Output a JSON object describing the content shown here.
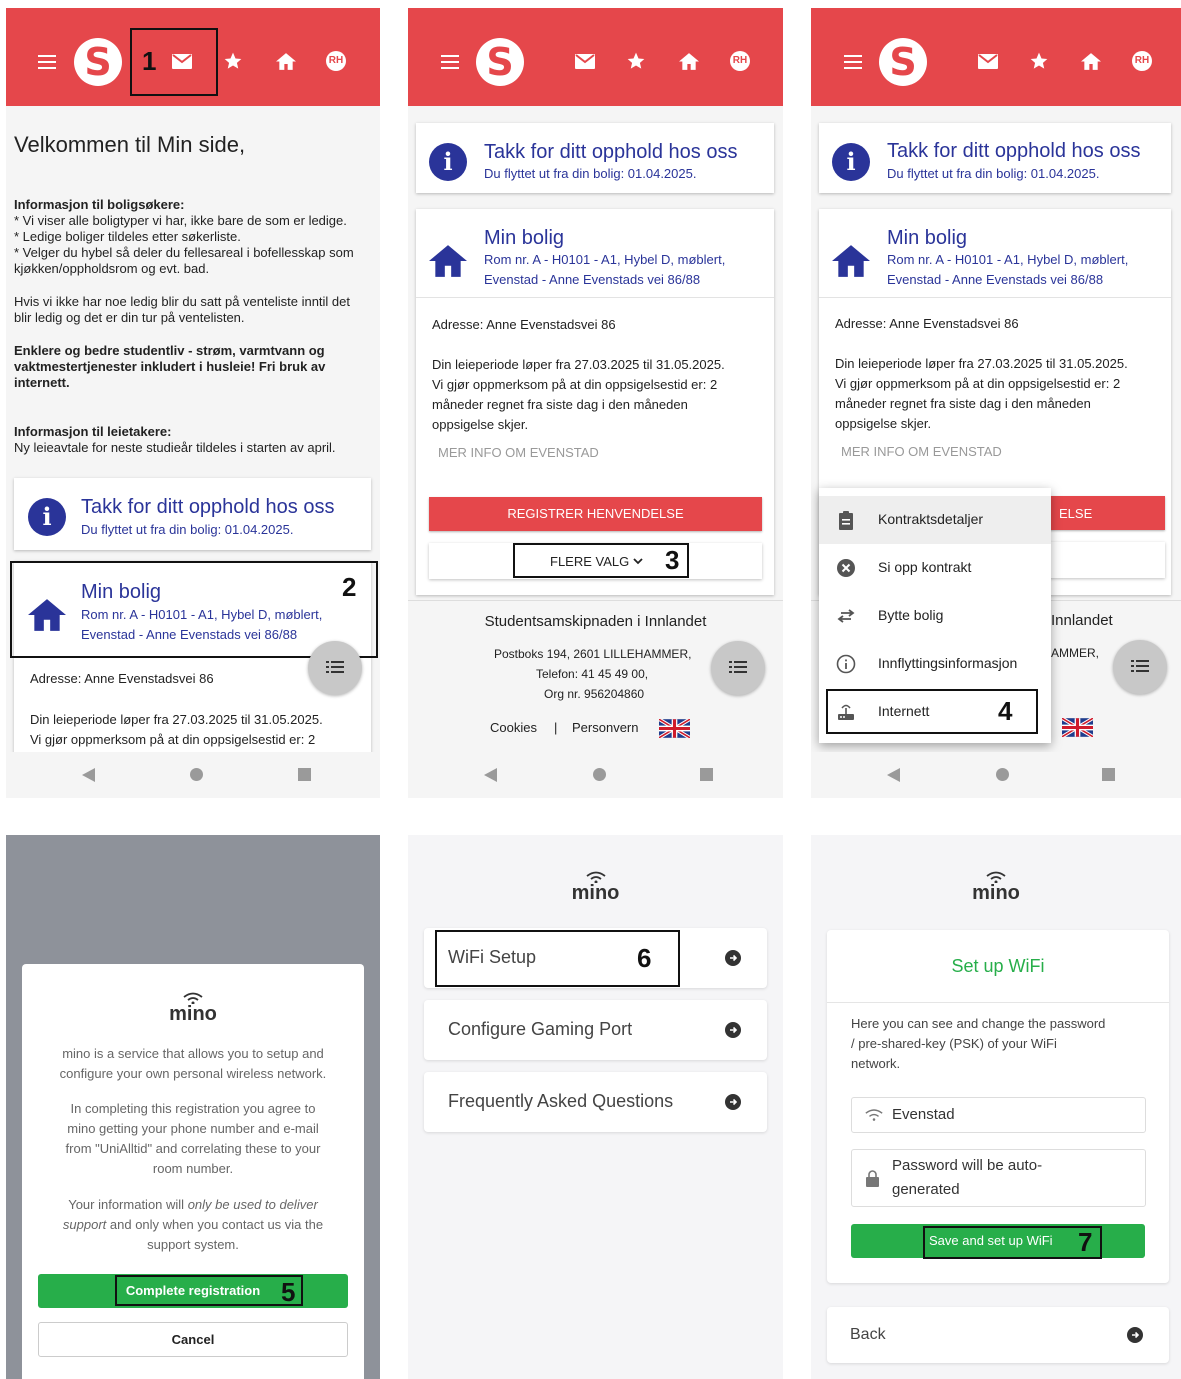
{
  "colors": {
    "brand_red": "#e5474b",
    "brand_blue": "#2a3499",
    "mino_green": "#27ae4a"
  },
  "appbar": {
    "avatar_initials": "RH",
    "logo_letter": "S"
  },
  "steps": [
    "1",
    "2",
    "3",
    "4",
    "5",
    "6",
    "7"
  ],
  "welcome": {
    "heading": "Velkommen til Min side,",
    "sec1_title": "Informasjon til boligsøkere:",
    "sec1_line1": "* Vi viser alle boligtyper vi har, ikke bare de som er ledige.",
    "sec1_line2": "* Ledige boliger tildeles etter søkerliste.",
    "sec1_line3": "* Velger du hybel så deler du fellesareal i bofellesskap som",
    "sec1_line4": "kjøkken/oppholdsrom og evt. bad.",
    "sec2_line1": "Hvis vi ikke har noe ledig blir du satt på venteliste inntil det",
    "sec2_line2": "blir ledig og det er din tur på ventelisten.",
    "sec3_line1": "Enklere og bedre studentliv - strøm, varmtvann og",
    "sec3_line2": "vaktmestertjenester inkludert i husleie! Fri bruk av",
    "sec3_line3": "internett.",
    "sec4_title": "Informasjon til leietakere:",
    "sec4_line1": "Ny leieavtale for neste studieår tildeles i starten av april."
  },
  "thanks": {
    "title": "Takk for ditt opphold hos oss",
    "subtitle": "Du flyttet ut fra din bolig: 01.04.2025."
  },
  "bolig": {
    "title": "Min bolig",
    "line1": "Rom nr. A - H0101 - A1, Hybel D, møblert,",
    "line2": "Evenstad - Anne Evenstads vei 86/88",
    "address": "Adresse: Anne Evenstadsvei 86",
    "period1": "Din leieperiode løper fra 27.03.2025 til 31.05.2025.",
    "period2": "Vi gjør oppmerksom på at din oppsigelsestid er: 2",
    "period3": "måneder regnet fra siste dag i den måneden",
    "period4": "oppsigelse skjer.",
    "more_info": "MER INFO OM EVENSTAD",
    "register": "REGISTRER HENVENDELSE",
    "register_partial": "ELSE",
    "more_options": "FLERE VALG"
  },
  "footer": {
    "org": "Studentsamskipnaden i Innlandet",
    "org_partial": "Innlandet",
    "address": "Postboks 194, 2601 LILLEHAMMER,",
    "address_partial": "AMMER,",
    "phone": "Telefon: 41 45 49 00,",
    "orgnr": "Org nr. 956204860",
    "cookies": "Cookies",
    "sep": "|",
    "privacy": "Personvern"
  },
  "menu": {
    "items": [
      {
        "label": "Kontraktsdetaljer",
        "icon": "clipboard-icon"
      },
      {
        "label": "Si opp kontrakt",
        "icon": "cancel-circle-icon"
      },
      {
        "label": "Bytte bolig",
        "icon": "swap-arrows-icon"
      },
      {
        "label": "Innflyttingsinformasjon",
        "icon": "info-outline-icon"
      },
      {
        "label": "Internett",
        "icon": "router-icon"
      }
    ]
  },
  "mino": {
    "logo": "mino",
    "intro1": "mino is a service that allows you to setup and",
    "intro2": "configure your own personal wireless network.",
    "agree1": "In completing this registration you agree to",
    "agree2": "mino getting your phone number and e-mail",
    "agree3": "from \"UniAlltid\" and correlating these to your",
    "agree4": "room number.",
    "use1a": "Your information will ",
    "use1b": "only be used to deliver",
    "use2a": "support",
    "use2b": " and only when you contact us via the",
    "use3": "support system.",
    "complete": "Complete registration",
    "cancel": "Cancel",
    "menu_items": [
      "WiFi Setup",
      "Configure Gaming Port",
      "Frequently Asked Questions"
    ],
    "setup_title": "Set up WiFi",
    "setup_desc1": "Here you can see and change the password",
    "setup_desc2": "/ pre-shared-key (PSK) of your WiFi",
    "setup_desc3": "network.",
    "ssid": "Evenstad",
    "password1": "Password will be auto-",
    "password2": "generated",
    "save": "Save and set up WiFi",
    "back": "Back"
  }
}
